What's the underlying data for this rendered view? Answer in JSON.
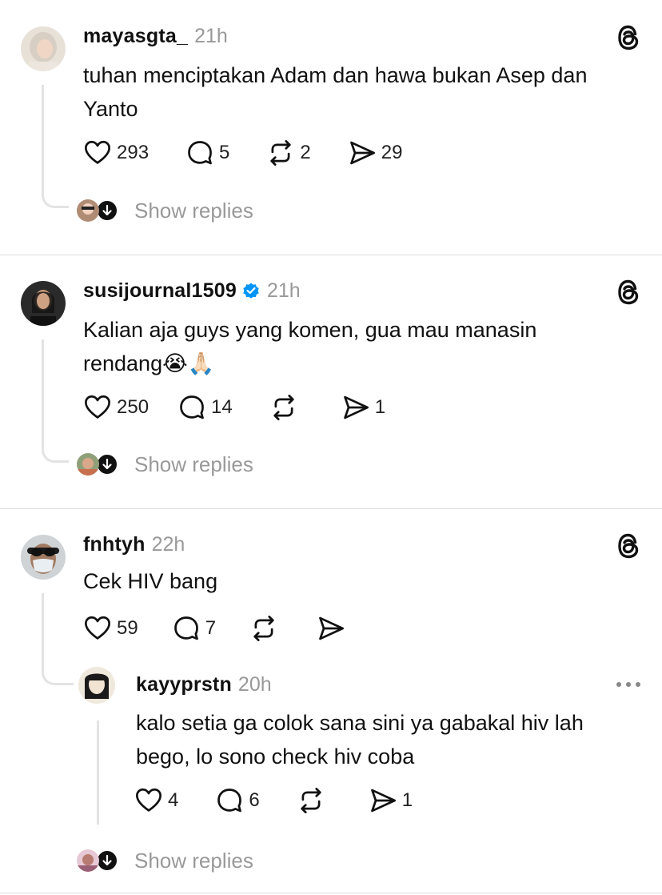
{
  "posts": [
    {
      "username": "mayasgta_",
      "time": "21h",
      "lines": [
        "tuhan menciptakan Adam dan hawa bukan Asep dan",
        "Yanto"
      ],
      "likes": "293",
      "replies": "5",
      "reposts": "2",
      "shares": "29",
      "show_replies": "Show replies"
    },
    {
      "username": "susijournal1509",
      "time": "21h",
      "verified": true,
      "lines": [
        "Kalian aja guys yang komen, gua mau manasin",
        "rendang"
      ],
      "emoji": [
        "😭",
        "🙏🏻"
      ],
      "likes": "250",
      "replies": "14",
      "reposts": "",
      "shares": "1",
      "show_replies": "Show replies"
    },
    {
      "username": "fnhtyh",
      "time": "22h",
      "lines": [
        "Cek HIV bang"
      ],
      "likes": "59",
      "replies": "7",
      "reposts": "",
      "shares": ""
    },
    {
      "username": "kayyprstn",
      "time": "20h",
      "lines": [
        "kalo setia ga colok sana sini ya gabakal hiv lah",
        "bego, lo sono check hiv coba"
      ],
      "likes": "4",
      "replies": "6",
      "reposts": "",
      "shares": "1",
      "show_replies": "Show replies"
    }
  ],
  "icons": {
    "threads": "threads-logo-icon",
    "like": "heart-icon",
    "reply": "comment-icon",
    "repost": "repost-icon",
    "share": "send-icon",
    "more": "more-icon",
    "expand": "arrow-down-icon"
  },
  "colors": {
    "verified": "#0095f6",
    "muted_text": "#999999",
    "thread_line": "#e3e3e3"
  }
}
